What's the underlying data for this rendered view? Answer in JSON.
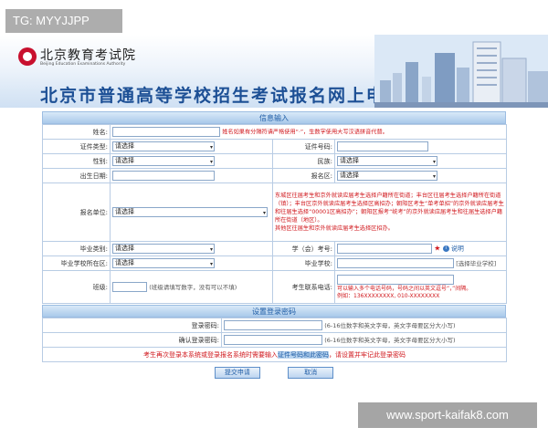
{
  "watermarks": {
    "top_left": "TG: MYYJJPP",
    "bottom_right": "www.sport-kaifak8.com"
  },
  "header": {
    "logo_cn": "北京教育考试院",
    "logo_en": "Beijing Education Examinations Authority",
    "title": "北京市普通高等学校招生考试报名网上申请"
  },
  "info_section": {
    "title": "信息输入",
    "name": {
      "label": "姓名:",
      "note": "姓名如果有分隔符请严格使用“·”，生数字使用大写汉语拼音代替。"
    },
    "id_type": {
      "label": "证件类型:",
      "selected": "请选择"
    },
    "id_number": {
      "label": "证件号码:",
      "value": ""
    },
    "gender": {
      "label": "性别:",
      "selected": "请选择"
    },
    "ethnicity": {
      "label": "民族:",
      "selected": "请选择"
    },
    "birth_date": {
      "label": "出生日期:",
      "value": ""
    },
    "reg_district": {
      "label": "报名区:",
      "selected": "请选择"
    },
    "reg_unit": {
      "label": "报名单位:",
      "selected": "请选择",
      "notes": [
        "东城区往届考生和京外就读应届考生选择户籍所在街道；丰台区往届考生选择户籍所在街道（镇）；丰台区京外就读应届考生选择区高招办；朝阳区考生“单考单招”的京外就读应届考生和往届生选择“00001区高招办”；朝阳区报考“统考”的京外就读应届考生和往届生选择户籍所在街道（地区）。",
        "其他区往届生和京外就读应届考生选择区招办。"
      ]
    },
    "grad_type": {
      "label": "毕业类别:",
      "selected": "请选择"
    },
    "school_id": {
      "label": "学（会）考号:",
      "value": "",
      "help": "说明"
    },
    "grad_district": {
      "label": "毕业学校所在区:",
      "selected": "请选择"
    },
    "grad_school": {
      "label": "毕业学校:",
      "value": "",
      "select_button": "[选择毕业学校]"
    },
    "class": {
      "label": "班级:",
      "value": "",
      "note": "(班级请填写数字，没有可以不填)"
    },
    "phone": {
      "label": "考生联系电话:",
      "value": "",
      "notes": [
        "可以输入多个电话号码，号码之间以英文逗号“，”间隔。",
        "例如：136XXXXXXXX, 010-XXXXXXXX"
      ]
    }
  },
  "password_section": {
    "title": "设置登录密码",
    "password": {
      "label": "登录密码:",
      "note": "(6-16位数字和英文字母，英文字母要区分大小写)"
    },
    "confirm": {
      "label": "确认登录密码:",
      "note": "(6-16位数字和英文字母，英文字母要区分大小写)"
    },
    "bottom_note_before": "考生再次登录本系统或登录报名系统时需要输入",
    "bottom_note_highlight": "证件号码和此密码",
    "bottom_note_after": "，请设置并牢记此登录密码"
  },
  "buttons": {
    "submit": "提交申请",
    "cancel": "取消"
  }
}
